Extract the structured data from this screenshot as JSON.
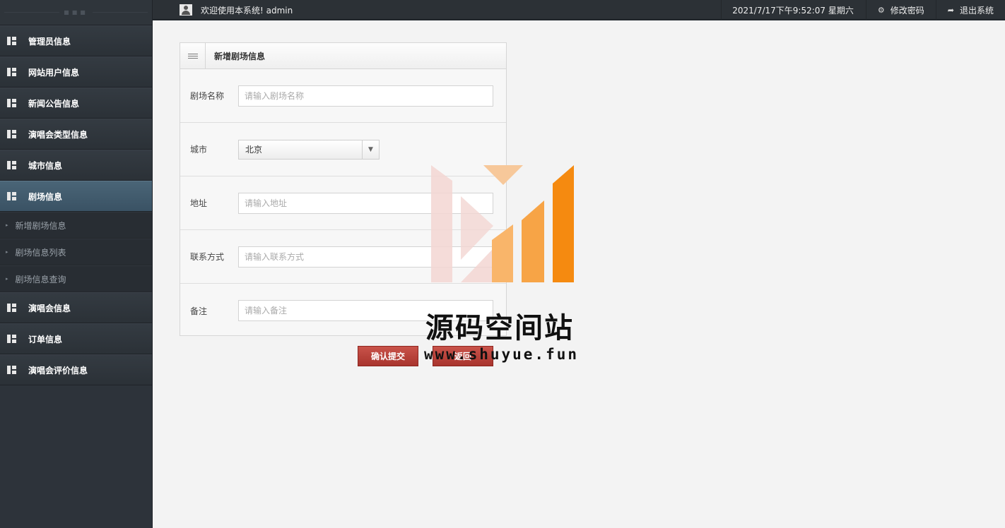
{
  "topbar": {
    "welcome": "欢迎使用本系统! admin",
    "datetime": "2021/7/17下午9:52:07 星期六",
    "change_password": "修改密码",
    "logout": "退出系统"
  },
  "sidebar": {
    "items_before": [
      {
        "label": "管理员信息"
      },
      {
        "label": "网站用户信息"
      },
      {
        "label": "新闻公告信息"
      },
      {
        "label": "演唱会类型信息"
      },
      {
        "label": "城市信息"
      }
    ],
    "active": {
      "label": "剧场信息"
    },
    "sub_items": [
      {
        "label": "新增剧场信息"
      },
      {
        "label": "剧场信息列表"
      },
      {
        "label": "剧场信息查询"
      }
    ],
    "items_after": [
      {
        "label": "演唱会信息"
      },
      {
        "label": "订单信息"
      },
      {
        "label": "演唱会评价信息"
      }
    ]
  },
  "form": {
    "title": "新增剧场信息",
    "name_label": "剧场名称",
    "name_placeholder": "请输入剧场名称",
    "city_label": "城市",
    "city_value": "北京",
    "address_label": "地址",
    "address_placeholder": "请输入地址",
    "contact_label": "联系方式",
    "contact_placeholder": "请输入联系方式",
    "remark_label": "备注",
    "remark_placeholder": "请输入备注",
    "submit_label": "确认提交",
    "back_label": "返回"
  },
  "watermark": {
    "name": "源码空间站",
    "url": "www.shuyue.fun"
  },
  "colors": {
    "sidebar_bg": "#2d333a",
    "active_item": "#4a6577",
    "button_red": "#b8403a",
    "main_bg": "#f3f3f3",
    "watermark_orange": "#f7941d"
  }
}
